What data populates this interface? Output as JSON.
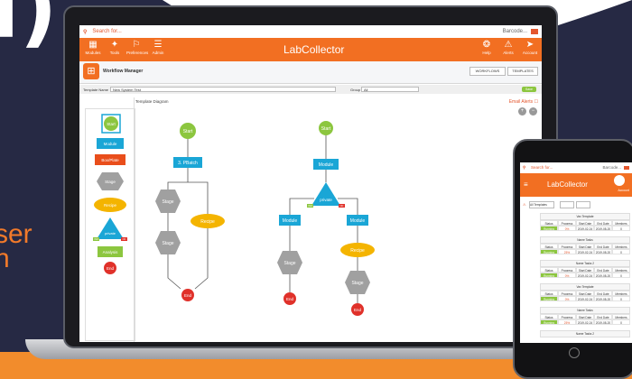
{
  "hero": {
    "brace": "i)",
    "line1": "ser",
    "line2": "n"
  },
  "app": {
    "search_placeholder": "Search for...",
    "barcode_label": "Barcode...",
    "brand": "LabCollector",
    "nav": [
      {
        "label": "Modules",
        "icon": "grid-icon"
      },
      {
        "label": "Tools",
        "icon": "wrench-icon"
      },
      {
        "label": "Preferences",
        "icon": "bookmark-icon"
      },
      {
        "label": "Admin",
        "icon": "sliders-icon"
      }
    ],
    "nav_right": [
      {
        "label": "Help",
        "icon": "help-icon"
      },
      {
        "label": "Alerts",
        "icon": "alert-icon"
      },
      {
        "label": "Account",
        "icon": "account-icon"
      }
    ],
    "page_title": "Workflow Manager",
    "buttons": {
      "workflows": "WORKFLOWS",
      "templates": "TEMPLATES"
    },
    "form": {
      "template_name_label": "Template Name",
      "template_name_value": "New System Test",
      "group_label": "Group",
      "group_value": "All",
      "save_label": "Save"
    },
    "canvas_title": "Template Diagram",
    "email_alerts": "Email Alerts",
    "palette": [
      "Start",
      "Module",
      "Box/Plate",
      "Stage",
      "Recipe",
      "private",
      "Analysis",
      "End"
    ],
    "palette_yes": "YES",
    "palette_no": "NO"
  },
  "diagram_left": {
    "start": "Start",
    "module": "3. PBatch",
    "stage1": "Stage",
    "stage2": "Stage",
    "recipe": "Recipe",
    "end": "End"
  },
  "diagram_right": {
    "start": "Start",
    "module": "Module",
    "decision": "private",
    "module_left": "Module",
    "module_right": "Module",
    "stage": "Stage",
    "recipe": "Recipe",
    "stage2": "Stage",
    "end_left": "End",
    "end_right": "End",
    "yes": "YES",
    "no": "NO"
  },
  "phone": {
    "search_placeholder": "Search for...",
    "barcode_label": "Barcode...",
    "brand": "LabCollector",
    "account": "Account",
    "filter": "All Templates",
    "table_headers": [
      "Status",
      "Progress",
      "Start Date",
      "End Date",
      "Members"
    ],
    "tables": [
      {
        "title": "Vax Template",
        "row": [
          "Running",
          "0%",
          "2019-02-24",
          "2019-08-20",
          "0"
        ]
      },
      {
        "title": "Name Tasks",
        "row": [
          "Running",
          "25%",
          "2019-02-24",
          "2019-08-20",
          "0"
        ]
      },
      {
        "title": "Name Tasks 2",
        "row": [
          "Running",
          "0%",
          "2019-02-24",
          "2019-08-20",
          "0"
        ]
      },
      {
        "title": "Vax Template",
        "row": [
          "Running",
          "0%",
          "2019-02-24",
          "2019-08-20",
          "0"
        ]
      },
      {
        "title": "Name Tasks",
        "row": [
          "Running",
          "25%",
          "2019-02-24",
          "2019-08-20",
          "0"
        ]
      },
      {
        "title": "Name Tasks 2",
        "row": []
      }
    ]
  },
  "colors": {
    "brand_orange": "#f26f22",
    "navy": "#262944",
    "green": "#8cc63f",
    "teal": "#1aa6d6",
    "yellow": "#f4b400",
    "red": "#e0312a",
    "grey": "#a0a0a0"
  }
}
